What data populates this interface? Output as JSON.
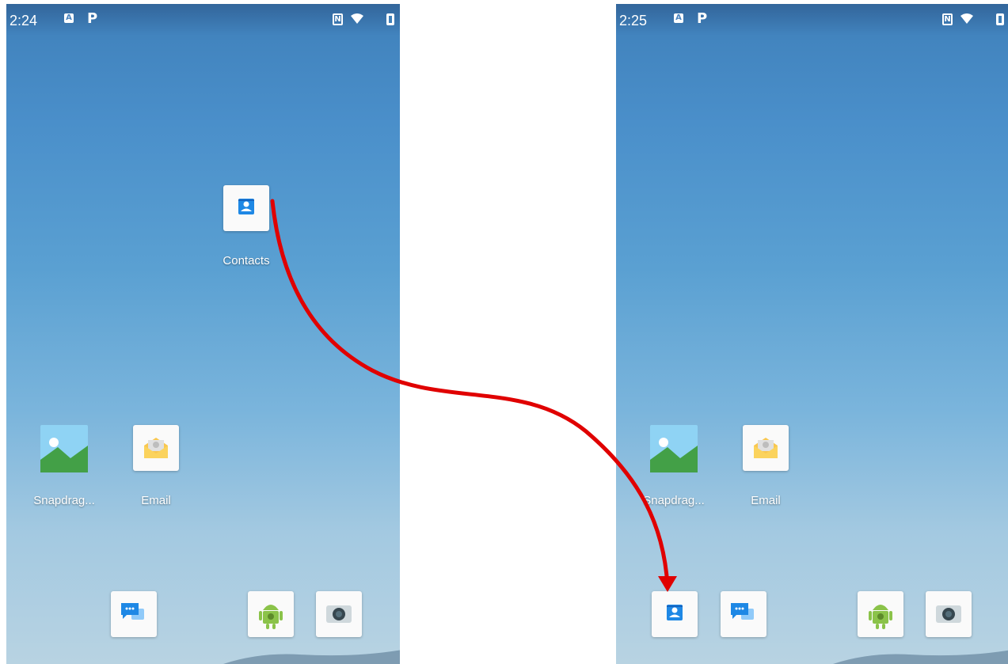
{
  "screens": {
    "left": {
      "status": {
        "time": "2:24",
        "icons": [
          "a-icon",
          "p-icon",
          "nfc-icon",
          "wifi-icon",
          "battery-icon"
        ]
      },
      "apps": {
        "contacts": "Contacts",
        "snapdragon": "Snapdrag...",
        "email": "Email"
      },
      "dock": [
        "messages-icon",
        "android-icon",
        "camera-icon"
      ]
    },
    "right": {
      "status": {
        "time": "2:25",
        "icons": [
          "a-icon",
          "p-icon",
          "nfc-icon",
          "wifi-icon",
          "battery-icon"
        ]
      },
      "apps": {
        "snapdragon": "Snapdrag...",
        "email": "Email"
      },
      "dock": [
        "contacts-icon",
        "messages-icon",
        "android-icon",
        "camera-icon"
      ]
    }
  },
  "colors": {
    "arrow": "#e00000",
    "contacts_blue": "#1e88e5",
    "email_yellow": "#f9c74f",
    "android_green": "#8bc34a"
  },
  "glyphs": {
    "a": "A",
    "p": "P",
    "nfc": "N"
  }
}
